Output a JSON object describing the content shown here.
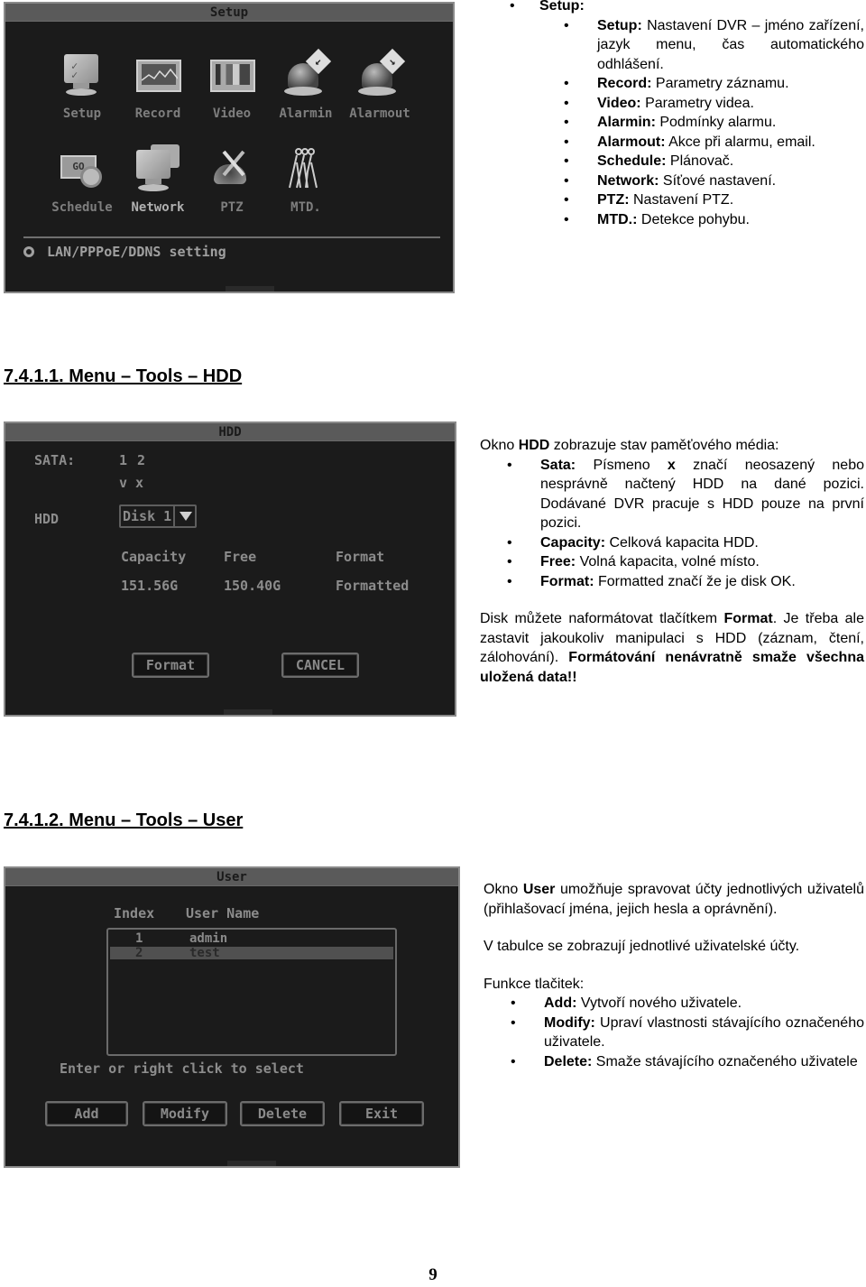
{
  "setup_window": {
    "title": "Setup",
    "tiles": [
      {
        "label": "Setup",
        "icon": "setup-monitor-icon"
      },
      {
        "label": "Record",
        "icon": "record-chart-icon"
      },
      {
        "label": "Video",
        "icon": "video-screen-icon"
      },
      {
        "label": "Alarmin",
        "icon": "alarm-in-siren-icon"
      },
      {
        "label": "Alarmout",
        "icon": "alarm-out-siren-icon"
      },
      {
        "label": "Schedule",
        "icon": "schedule-clock-icon"
      },
      {
        "label": "Network",
        "icon": "network-monitors-icon"
      },
      {
        "label": "PTZ",
        "icon": "ptz-camera-tools-icon"
      },
      {
        "label": "MTD.",
        "icon": "motion-detection-icon"
      }
    ],
    "active_tile": "Network",
    "status_hint": "LAN/PPPoE/DDNS setting"
  },
  "setup_text": {
    "heading_bullet": "Setup:",
    "items": [
      {
        "term": "Setup:",
        "desc": "Nastavení DVR – jméno zařízení, jazyk menu, čas automatického odhlášení."
      },
      {
        "term": "Record:",
        "desc": "Parametry záznamu."
      },
      {
        "term": "Video:",
        "desc": "Parametry videa."
      },
      {
        "term": "Alarmin:",
        "desc": "Podmínky alarmu."
      },
      {
        "term": "Alarmout:",
        "desc": "Akce při alarmu, email."
      },
      {
        "term": "Schedule:",
        "desc": "Plánovač."
      },
      {
        "term": "Network:",
        "desc": "Síťové nastavení."
      },
      {
        "term": "PTZ:",
        "desc": "Nastavení PTZ."
      },
      {
        "term": "MTD.:",
        "desc": "Detekce pohybu."
      }
    ]
  },
  "section_hdd": {
    "heading": "7.4.1.1. Menu – Tools – HDD",
    "window": {
      "title": "HDD",
      "sata_label": "SATA:",
      "sata_slots": "1 2",
      "sata_status": "v x",
      "hdd_label": "HDD",
      "disk_select_value": "Disk 1",
      "columns": [
        "Capacity",
        "Free",
        "Format"
      ],
      "values": [
        "151.56G",
        "150.40G",
        "Formatted"
      ],
      "format_button": "Format",
      "cancel_button": "CANCEL"
    },
    "intro_pre": "Okno ",
    "intro_bold": "HDD",
    "intro_post": " zobrazuje stav paměťového média:",
    "items": [
      {
        "term": "Sata:",
        "desc_pre": " Písmeno ",
        "desc_bold": "x",
        "desc_post": " značí neosazený nebo nesprávně načtený HDD na dané pozici. Dodávané DVR pracuje s HDD pouze na první pozici."
      },
      {
        "term": "Capacity:",
        "desc_pre": " Celková kapacita HDD.",
        "desc_bold": "",
        "desc_post": ""
      },
      {
        "term": "Free:",
        "desc_pre": " Volná kapacita, volné místo.",
        "desc_bold": "",
        "desc_post": ""
      },
      {
        "term": "Format:",
        "desc_pre": " Formatted značí že je disk OK.",
        "desc_bold": "",
        "desc_post": ""
      }
    ],
    "note_pre": "Disk můžete naformátovat tlačítkem ",
    "note_bold1": "Format",
    "note_mid": ". Je třeba ale zastavit jakoukoliv manipulaci s HDD (záznam, čtení, zálohování). ",
    "note_bold2": "Formátování nenávratně smaže všechna uložená data!!"
  },
  "section_user": {
    "heading": "7.4.1.2. Menu – Tools – User",
    "window": {
      "title": "User",
      "columns": [
        "Index",
        "User Name"
      ],
      "rows": [
        {
          "index": "1",
          "name": "admin"
        },
        {
          "index": "2",
          "name": "test"
        }
      ],
      "selected_index": "2",
      "hint": "Enter or right click to select",
      "buttons": [
        "Add",
        "Modify",
        "Delete",
        "Exit"
      ]
    },
    "intro_pre": "Okno ",
    "intro_bold": "User",
    "intro_post": " umožňuje spravovat účty jednotlivých uživatelů (přihlašovací jména, jejich hesla a oprávnění).",
    "table_note": "V tabulce se zobrazují jednotlivé uživatelské účty.",
    "functions_label": "Funkce tlačitek:",
    "items": [
      {
        "term": "Add:",
        "desc": " Vytvoří nového uživatele."
      },
      {
        "term": "Modify:",
        "desc": " Upraví vlastnosti stávajícího označeného uživatele."
      },
      {
        "term": "Delete:",
        "desc": " Smaže stávajícího označeného uživatele"
      }
    ]
  },
  "page_number": "9",
  "bullet_glyph": "•"
}
